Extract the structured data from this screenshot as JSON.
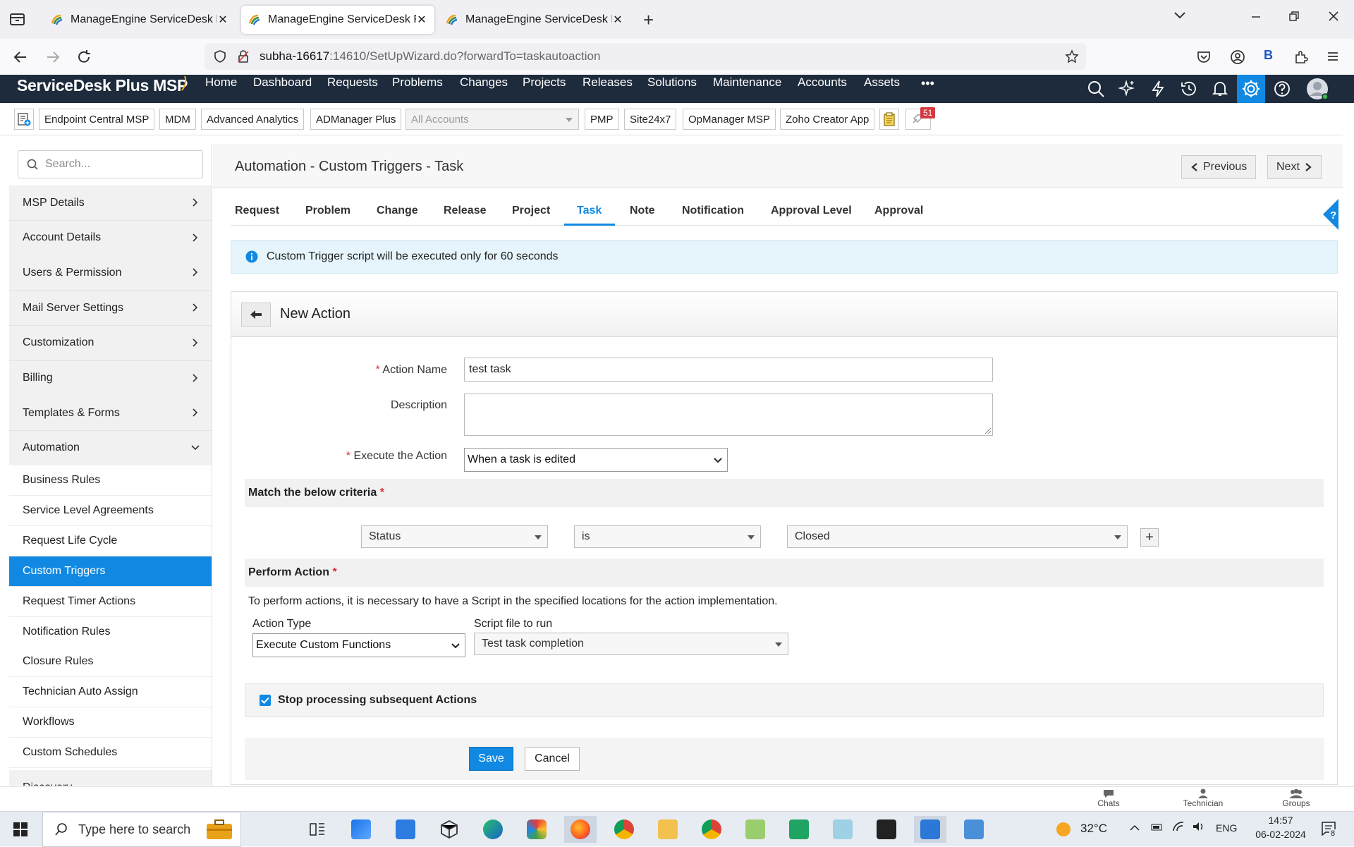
{
  "browser": {
    "tabs": [
      {
        "title": "ManageEngine ServiceDesk Plu",
        "active": false
      },
      {
        "title": "ManageEngine ServiceDesk Plu",
        "active": true
      },
      {
        "title": "ManageEngine ServiceDesk Plu",
        "active": false
      }
    ],
    "url_host": "subha-16617",
    "url_rest": ":14610/SetUpWizard.do?forwardTo=taskautoaction",
    "ext_badge": "B"
  },
  "app": {
    "logo": "ServiceDesk Plus MSP",
    "nav": [
      "Home",
      "Dashboard",
      "Requests",
      "Problems",
      "Changes",
      "Projects",
      "Releases",
      "Solutions",
      "Maintenance",
      "Accounts",
      "Assets"
    ],
    "more": "•••"
  },
  "toolbar": {
    "buttons": [
      "Endpoint Central MSP",
      "MDM",
      "Advanced Analytics",
      "ADManager Plus"
    ],
    "account_select": "All Accounts",
    "buttons2": [
      "PMP",
      "Site24x7",
      "OpManager MSP",
      "Zoho Creator App"
    ],
    "badge_count": "51"
  },
  "sidebar": {
    "search_placeholder": "Search...",
    "sections": [
      "MSP Details",
      "Account Details",
      "Users & Permission",
      "Mail Server Settings",
      "Customization",
      "Billing",
      "Templates & Forms",
      "Automation"
    ],
    "automation_items": [
      "Business Rules",
      "Service Level Agreements",
      "Request Life Cycle",
      "Custom Triggers",
      "Request Timer Actions",
      "Notification Rules",
      "Closure Rules",
      "Technician Auto Assign",
      "Workflows",
      "Custom Schedules"
    ],
    "active_item": "Custom Triggers",
    "after": "Discovery"
  },
  "page": {
    "title": "Automation - Custom Triggers - Task",
    "previous": "Previous",
    "next": "Next",
    "tabs": [
      "Request",
      "Problem",
      "Change",
      "Release",
      "Project",
      "Task",
      "Note",
      "Notification",
      "Approval Level",
      "Approval"
    ],
    "active_tab": "Task",
    "info": "Custom Trigger script will be executed only for 60 seconds",
    "help": "?"
  },
  "form": {
    "heading": "New Action",
    "required_mark": "*",
    "action_name_label": "Action Name",
    "action_name_value": "test task",
    "description_label": "Description",
    "description_value": "",
    "execute_label": "Execute the Action",
    "execute_value": "When a task is edited",
    "criteria_heading": "Match the below criteria",
    "criteria": {
      "field": "Status",
      "operator": "is",
      "value": "Closed"
    },
    "add_criteria": "+",
    "perform_heading": "Perform Action",
    "perform_note": "To perform actions, it is necessary to have a Script in the specified locations for the action implementation.",
    "action_type_label": "Action Type",
    "action_type_value": "Execute Custom Functions",
    "script_label": "Script file to run",
    "script_value": "Test task completion",
    "stop_processing_label": "Stop processing subsequent Actions",
    "stop_processing_checked": true,
    "save": "Save",
    "cancel": "Cancel"
  },
  "bottom_bar": [
    "Chats",
    "Technician",
    "Groups"
  ],
  "taskbar": {
    "search_placeholder": "Type here to search",
    "temperature": "32°C",
    "language": "ENG",
    "time": "14:57",
    "date": "06-02-2024",
    "notification_count": "8"
  },
  "colors": {
    "accent": "#1189e2",
    "header": "#1e2b3c",
    "required": "#dd3333"
  }
}
